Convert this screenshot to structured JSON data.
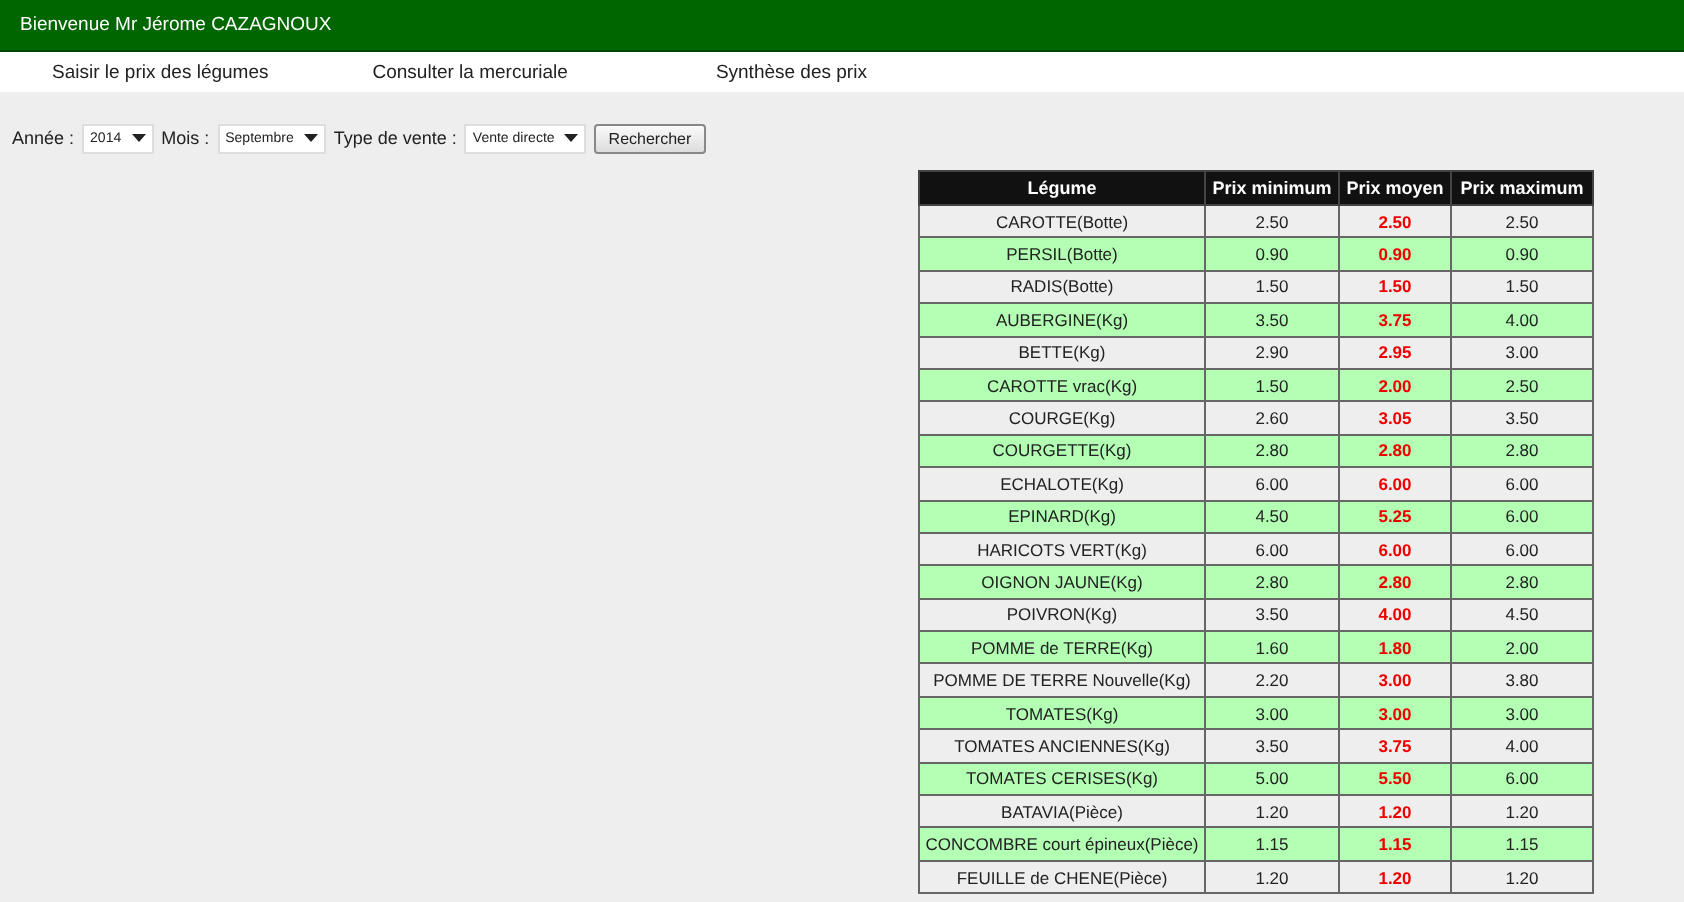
{
  "header": {
    "welcome": "Bienvenue Mr Jérome CAZAGNOUX"
  },
  "nav": [
    "Saisir le prix des légumes",
    "Consulter la mercuriale",
    "Synthèse des prix"
  ],
  "filters": [
    {
      "label": "Année :",
      "value": "2014"
    },
    {
      "label": "Mois :",
      "value": "Septembre"
    },
    {
      "label": "Type de vente :",
      "value": "Vente directe"
    }
  ],
  "search_button": "Rechercher",
  "table": {
    "columns": [
      "Légume",
      "Prix minimum",
      "Prix moyen",
      "Prix maximum"
    ],
    "rows": [
      [
        "CAROTTE(Botte)",
        "2.50",
        "2.50",
        "2.50"
      ],
      [
        "PERSIL(Botte)",
        "0.90",
        "0.90",
        "0.90"
      ],
      [
        "RADIS(Botte)",
        "1.50",
        "1.50",
        "1.50"
      ],
      [
        "AUBERGINE(Kg)",
        "3.50",
        "3.75",
        "4.00"
      ],
      [
        "BETTE(Kg)",
        "2.90",
        "2.95",
        "3.00"
      ],
      [
        "CAROTTE vrac(Kg)",
        "1.50",
        "2.00",
        "2.50"
      ],
      [
        "COURGE(Kg)",
        "2.60",
        "3.05",
        "3.50"
      ],
      [
        "COURGETTE(Kg)",
        "2.80",
        "2.80",
        "2.80"
      ],
      [
        "ECHALOTE(Kg)",
        "6.00",
        "6.00",
        "6.00"
      ],
      [
        "EPINARD(Kg)",
        "4.50",
        "5.25",
        "6.00"
      ],
      [
        "HARICOTS VERT(Kg)",
        "6.00",
        "6.00",
        "6.00"
      ],
      [
        "OIGNON JAUNE(Kg)",
        "2.80",
        "2.80",
        "2.80"
      ],
      [
        "POIVRON(Kg)",
        "3.50",
        "4.00",
        "4.50"
      ],
      [
        "POMME de TERRE(Kg)",
        "1.60",
        "1.80",
        "2.00"
      ],
      [
        "POMME DE TERRE Nouvelle(Kg)",
        "2.20",
        "3.00",
        "3.80"
      ],
      [
        "TOMATES(Kg)",
        "3.00",
        "3.00",
        "3.00"
      ],
      [
        "TOMATES ANCIENNES(Kg)",
        "3.50",
        "3.75",
        "4.00"
      ],
      [
        "TOMATES CERISES(Kg)",
        "5.00",
        "5.50",
        "6.00"
      ],
      [
        "BATAVIA(Pièce)",
        "1.20",
        "1.20",
        "1.20"
      ],
      [
        "CONCOMBRE court épineux(Pièce)",
        "1.15",
        "1.15",
        "1.15"
      ],
      [
        "FEUILLE de CHENE(Pièce)",
        "1.20",
        "1.20",
        "1.20"
      ]
    ]
  }
}
